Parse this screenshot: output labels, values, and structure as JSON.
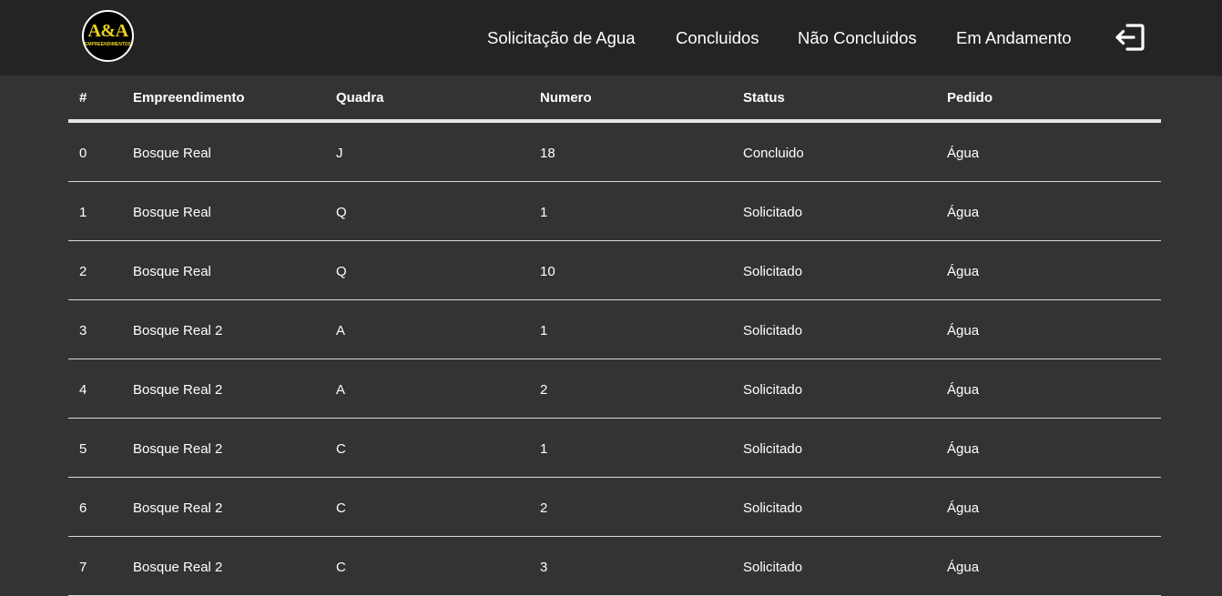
{
  "brand": {
    "logo_text": "A&A",
    "logo_subtext": "EMPREENDIMENTOS"
  },
  "nav": {
    "items": [
      {
        "label": "Solicitação de Agua"
      },
      {
        "label": "Concluidos"
      },
      {
        "label": "Não Concluidos"
      },
      {
        "label": "Em Andamento"
      }
    ],
    "logout_icon": "logout-icon"
  },
  "table": {
    "columns": [
      "#",
      "Empreendimento",
      "Quadra",
      "Numero",
      "Status",
      "Pedido"
    ],
    "rows": [
      [
        "0",
        "Bosque Real",
        "J",
        "18",
        "Concluido",
        "Água"
      ],
      [
        "1",
        "Bosque Real",
        "Q",
        "1",
        "Solicitado",
        "Água"
      ],
      [
        "2",
        "Bosque Real",
        "Q",
        "10",
        "Solicitado",
        "Água"
      ],
      [
        "3",
        "Bosque Real 2",
        "A",
        "1",
        "Solicitado",
        "Água"
      ],
      [
        "4",
        "Bosque Real 2",
        "A",
        "2",
        "Solicitado",
        "Água"
      ],
      [
        "5",
        "Bosque Real 2",
        "C",
        "1",
        "Solicitado",
        "Água"
      ],
      [
        "6",
        "Bosque Real 2",
        "C",
        "2",
        "Solicitado",
        "Água"
      ],
      [
        "7",
        "Bosque Real 2",
        "C",
        "3",
        "Solicitado",
        "Água"
      ]
    ]
  },
  "colors": {
    "background": "#333333",
    "navbar": "#242424",
    "logo_accent": "#e8d21c"
  }
}
